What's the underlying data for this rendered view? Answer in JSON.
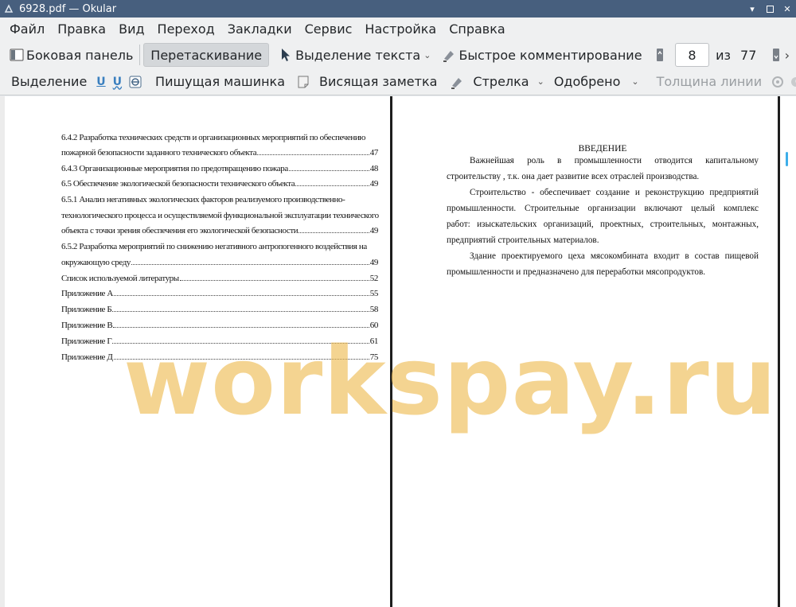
{
  "window": {
    "title": "6928.pdf  — Okular",
    "app_icon": "okular-icon",
    "buttons": [
      "minimize",
      "maximize",
      "close"
    ]
  },
  "menubar": {
    "items": [
      "Файл",
      "Правка",
      "Вид",
      "Переход",
      "Закладки",
      "Сервис",
      "Настройка",
      "Справка"
    ]
  },
  "toolbar1": {
    "sidebar_label": "Боковая панель",
    "drag_label": "Перетаскивание",
    "text_select_label": "Выделение текста",
    "quick_comment_label": "Быстрое комментирование",
    "page_current": "8",
    "page_of_label": "из",
    "page_total": "77"
  },
  "toolbar2": {
    "selection_label": "Выделение",
    "typewriter_label": "Пишущая машинка",
    "sticky_note_label": "Висящая заметка",
    "arrow_label": "Стрелка",
    "stamp_label": "Одобрено",
    "line_width_label": "Толщина линии"
  },
  "toc": [
    {
      "text": "6.4.2 Разработка технических средств и организационных мероприятий по обеспечению",
      "page": ""
    },
    {
      "text": "пожарной безопасности заданного технического объекта",
      "page": "47"
    },
    {
      "text": "6.4.3 Организационные мероприятия по предотвращению пожара",
      "page": "48"
    },
    {
      "text": "6.5 Обеспечение экологической безопасности технического объекта",
      "page": "49"
    },
    {
      "text": "6.5.1 Анализ негативных экологических факторов реализуемого производственно-",
      "page": ""
    },
    {
      "text": "технологического процесса  и осуществляемой функциональной эксплуатации  технического",
      "page": ""
    },
    {
      "text": "объекта с точки зрения обеспечения его экологической безопасности",
      "page": "49"
    },
    {
      "text": "6.5.2 Разработка мероприятий по снижению негативного антропогенного воздействия на",
      "page": ""
    },
    {
      "text": "окружающую среду",
      "page": "49"
    },
    {
      "text": "Список используемой литературы",
      "page": "52"
    },
    {
      "text": "Приложение А",
      "page": "55"
    },
    {
      "text": "Приложение Б",
      "page": "58"
    },
    {
      "text": "Приложение В",
      "page": "60"
    },
    {
      "text": "Приложение Г",
      "page": "61"
    },
    {
      "text": "Приложение Д",
      "page": "75"
    }
  ],
  "intro": {
    "title": "ВВЕДЕНИЕ",
    "lines": [
      "Важнейшая    роль    в    промышленности    отводится    капитальному",
      "строительству , т.к. она дает развитие всех отраслей производства.",
      "Строительство - обеспечивает создание и реконструкцию предприятий",
      "промышленности. Строительные организации включают целый комплекс",
      "работ: изыскательских организаций, проектных, строительных, монтажных,",
      "предприятий строительных материалов.",
      "Здание проектируемого цеха мясокомбината входит в состав пищевой",
      "промышленности и предназначено для переработки мясопродуктов."
    ]
  },
  "watermark": {
    "text": "workspay.ru",
    "color": "#eeba4e"
  }
}
